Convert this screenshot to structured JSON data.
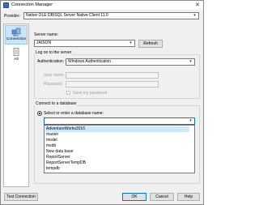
{
  "window": {
    "title": "Connection Manager",
    "close_glyph": "✕"
  },
  "provider": {
    "label": "Provider:",
    "value": "Native OLE DB\\SQL Server Native Client 11.0"
  },
  "sidebar": {
    "items": [
      {
        "label": "Connection",
        "icon": "connection-icon",
        "selected": true
      },
      {
        "label": "All",
        "icon": "all-properties-icon",
        "selected": false
      }
    ]
  },
  "server": {
    "label": "Server name:",
    "value": "JAISON",
    "refresh_label": "Refresh"
  },
  "logon": {
    "group_label": "Log on to the server",
    "auth_label": "Authentication:",
    "auth_value": "Windows Authentication",
    "username_label": "User name:",
    "password_label": "Password:",
    "save_password_label": "Save my password"
  },
  "database": {
    "group_label": "Connect to a database",
    "select_label": "Select or enter a database name:",
    "input_value": "",
    "options": [
      "AdventureWorks2016",
      "master",
      "model",
      "msdb",
      "New data base",
      "ReportServer",
      "ReportServerTempDB",
      "tempdb"
    ],
    "highlighted_index": 0
  },
  "footer": {
    "test_label": "Test Connection",
    "ok_label": "OK",
    "cancel_label": "Cancel",
    "help_label": "Help"
  },
  "colors": {
    "accent": "#0078d7",
    "selection": "#cce8ff"
  }
}
